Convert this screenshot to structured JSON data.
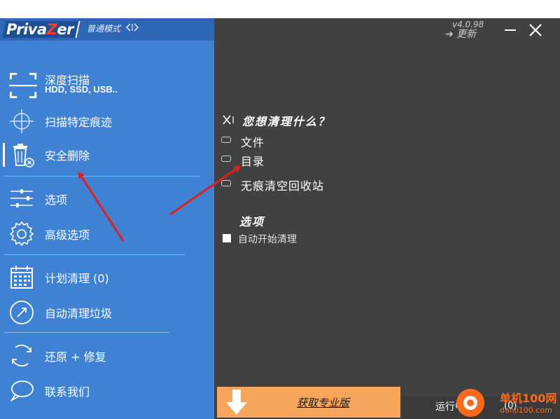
{
  "app": {
    "logo_text_1": "Priva",
    "logo_text_2": "Z",
    "logo_text_3": "er",
    "mode_label": "普通模式",
    "version": "v4.0.98",
    "update_label": "➔ 更新"
  },
  "sidebar": {
    "items": [
      {
        "label": "深度扫描",
        "sublabel": "HDD, SSD, USB..",
        "icon": "scan-frame-icon"
      },
      {
        "label": "扫描特定痕迹",
        "icon": "crosshair-icon"
      },
      {
        "label": "安全删除",
        "icon": "trash-delete-icon"
      },
      {
        "label": "选项",
        "icon": "sliders-icon"
      },
      {
        "label": "高级选项",
        "icon": "gear-icon"
      },
      {
        "label": "计划清理 (0)",
        "icon": "calendar-icon"
      },
      {
        "label": "自动清理垃圾",
        "icon": "gauge-icon"
      },
      {
        "label": "还原 + 修复",
        "icon": "restore-icon"
      },
      {
        "label": "联系我们",
        "icon": "chat-icon"
      }
    ]
  },
  "main": {
    "question": "您想清理什么？",
    "options": [
      {
        "label": "文件"
      },
      {
        "label": "目录"
      },
      {
        "label": "无痕清空回收站"
      }
    ],
    "options_heading": "选项",
    "auto_clean_label": "自动开始清理"
  },
  "footer": {
    "pro_label": "获取专业版",
    "running_label": "运行中的",
    "running_count": "(0)"
  },
  "watermark": {
    "line1": "单机100网",
    "line2": "danji100.com"
  },
  "colors": {
    "sidebar_bg": "#3f82d4",
    "main_bg": "#414141",
    "pro_button": "#f6a55c",
    "annotation_arrow": "#e0201a",
    "watermark": "#ff6a1a"
  }
}
